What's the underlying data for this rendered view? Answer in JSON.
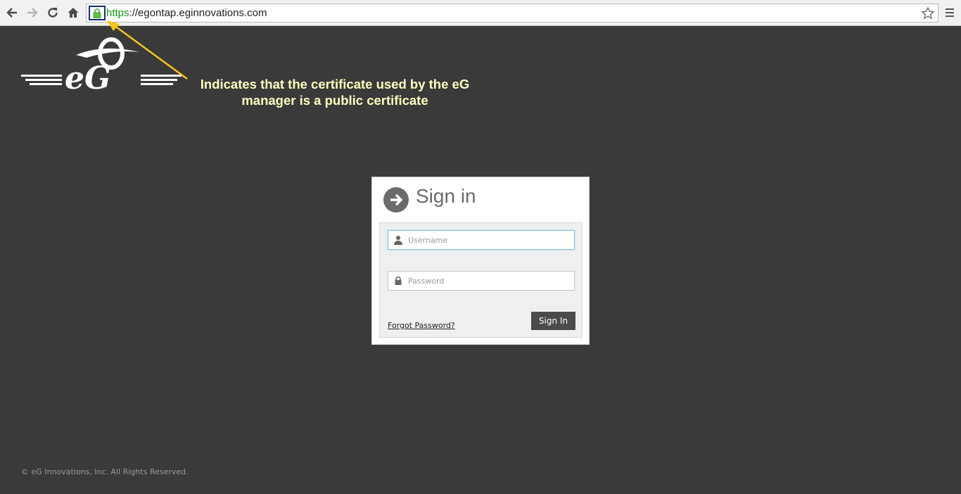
{
  "browser": {
    "url_scheme": "https",
    "url_rest": "://egontap.eginnovations.com"
  },
  "annotation": {
    "text_line1": "Indicates that the certificate used by the eG",
    "text_line2": "manager is a public certificate"
  },
  "signin": {
    "title": "Sign in",
    "username_placeholder": "Username",
    "password_placeholder": "Password",
    "forgot_label": "Forgot Password?",
    "button_label": "Sign In"
  },
  "footer": {
    "copyright": "© eG Innovations, Inc. All Rights Reserved."
  },
  "colors": {
    "background": "#3a3a3a",
    "annotation": "#ffffc0",
    "arrow": "#f5c518",
    "secure_green": "#109b10",
    "button": "#4b4b4b"
  }
}
